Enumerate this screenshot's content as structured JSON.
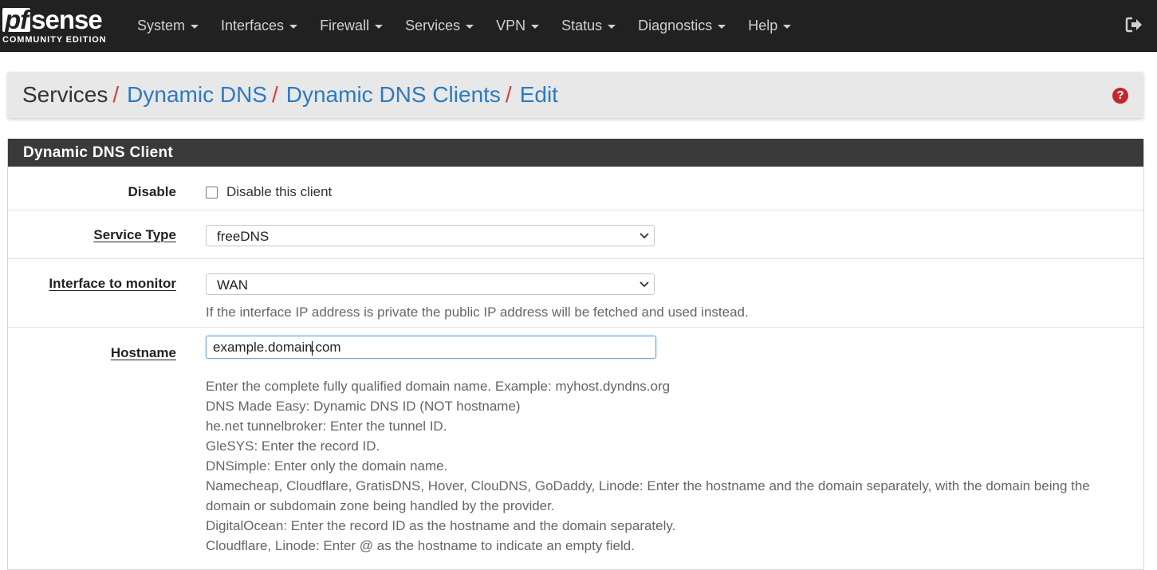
{
  "brand": {
    "logo_prefix": "pf",
    "logo_suffix": "sense",
    "edition": "COMMUNITY EDITION"
  },
  "nav": {
    "items": [
      {
        "label": "System"
      },
      {
        "label": "Interfaces"
      },
      {
        "label": "Firewall"
      },
      {
        "label": "Services"
      },
      {
        "label": "VPN"
      },
      {
        "label": "Status"
      },
      {
        "label": "Diagnostics"
      },
      {
        "label": "Help"
      }
    ],
    "logout_icon": "sign-out-icon"
  },
  "breadcrumb": {
    "root": "Services",
    "links": [
      "Dynamic DNS",
      "Dynamic DNS Clients",
      "Edit"
    ],
    "separator": "/",
    "help_icon": "question-circle-icon"
  },
  "panel": {
    "title": "Dynamic DNS Client",
    "disable": {
      "label": "Disable",
      "checkbox_label": "Disable this client",
      "checked": false
    },
    "service_type": {
      "label": "Service Type",
      "value": "freeDNS"
    },
    "interface": {
      "label": "Interface to monitor",
      "value": "WAN",
      "help": "If the interface IP address is private the public IP address will be fetched and used instead."
    },
    "hostname": {
      "label": "Hostname",
      "value_before_cursor": "example.domain",
      "value_after_cursor": ".com",
      "help": [
        "Enter the complete fully qualified domain name. Example: myhost.dyndns.org",
        "DNS Made Easy: Dynamic DNS ID (NOT hostname)",
        "he.net tunnelbroker: Enter the tunnel ID.",
        "GleSYS: Enter the record ID.",
        "DNSimple: Enter only the domain name.",
        "Namecheap, Cloudflare, GratisDNS, Hover, ClouDNS, GoDaddy, Linode: Enter the hostname and the domain separately, with the domain being the",
        "domain or subdomain zone being handled by the provider.",
        "DigitalOcean: Enter the record ID as the hostname and the domain separately.",
        "Cloudflare, Linode: Enter @ as the hostname to indicate an empty field."
      ]
    }
  },
  "colors": {
    "navbar": "#212121",
    "link": "#2d7ac2",
    "separator": "#d24040",
    "help_icon": "#c1272d",
    "panel_heading": "#3a3a3a"
  }
}
